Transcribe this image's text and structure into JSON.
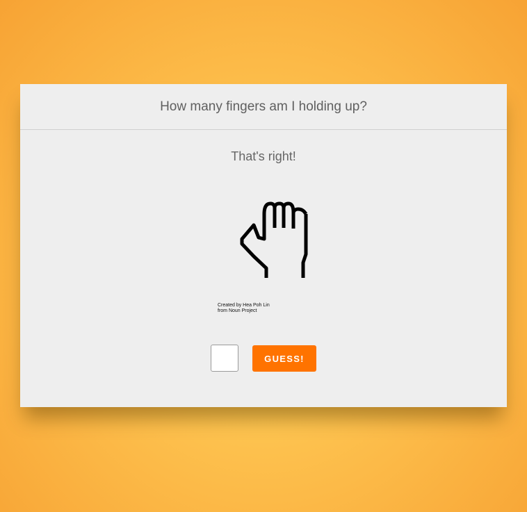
{
  "game": {
    "question": "How many fingers am I holding up?",
    "feedback": "That's right!",
    "image_icon": "fist-icon",
    "credit_line1": "Created by Hea Poh Lin",
    "credit_line2": "from Noun Project",
    "guess_value": "",
    "guess_button_label": "GUESS!"
  },
  "colors": {
    "background_center": "#ffd75e",
    "background_edge": "#f7a334",
    "card": "#eeeeee",
    "button": "#ff7300",
    "button_text": "#ffffff"
  }
}
